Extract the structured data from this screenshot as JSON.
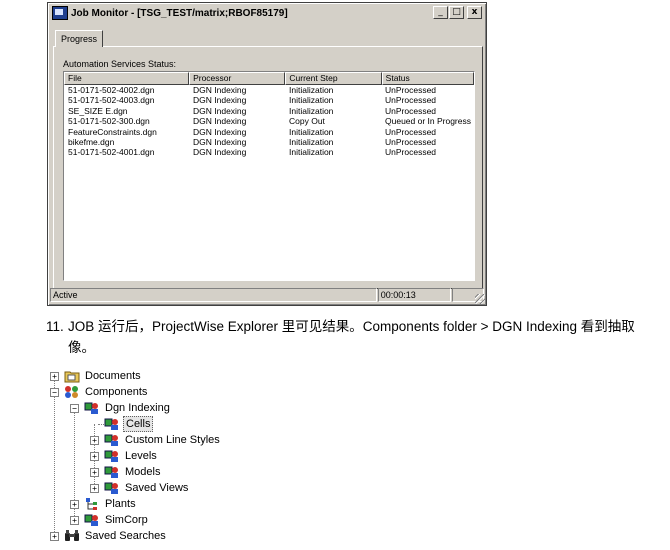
{
  "window": {
    "title": "Job Monitor - [TSG_TEST/matrix;RBOF85179]",
    "controls": {
      "minimize": "_",
      "maximize": "□",
      "close": "x"
    },
    "tab_label": "Progress",
    "panel_label": "Automation Services Status:",
    "columns": [
      "File",
      "Processor",
      "Current Step",
      "Status"
    ],
    "rows": [
      [
        "51-0171-502-4002.dgn",
        "DGN Indexing",
        "Initialization",
        "UnProcessed"
      ],
      [
        "51-0171-502-4003.dgn",
        "DGN Indexing",
        "Initialization",
        "UnProcessed"
      ],
      [
        "SE_SIZE E.dgn",
        "DGN Indexing",
        "Initialization",
        "UnProcessed"
      ],
      [
        "51-0171-502-300.dgn",
        "DGN Indexing",
        "Copy Out",
        "Queued or In Progress"
      ],
      [
        "FeatureConstraints.dgn",
        "DGN Indexing",
        "Initialization",
        "UnProcessed"
      ],
      [
        "bikefme.dgn",
        "DGN Indexing",
        "Initialization",
        "UnProcessed"
      ],
      [
        "51-0171-502-4001.dgn",
        "DGN Indexing",
        "Initialization",
        "UnProcessed"
      ]
    ],
    "status_text": "Active",
    "elapsed_time": "00:00:13"
  },
  "instruction": {
    "number": "11.",
    "text": "JOB 运行后，ProjectWise Explorer 里可见结果。Components folder > DGN Indexing 看到抽取像。"
  },
  "tree": {
    "documents": "Documents",
    "components": "Components",
    "dgn_indexing": "Dgn Indexing",
    "cells": "Cells",
    "custom_line_styles": "Custom Line Styles",
    "levels": "Levels",
    "models": "Models",
    "saved_views": "Saved Views",
    "plants": "Plants",
    "simcorp": "SimCorp",
    "saved_searches": "Saved Searches",
    "expand_symbol": "+",
    "collapse_symbol": "−"
  }
}
